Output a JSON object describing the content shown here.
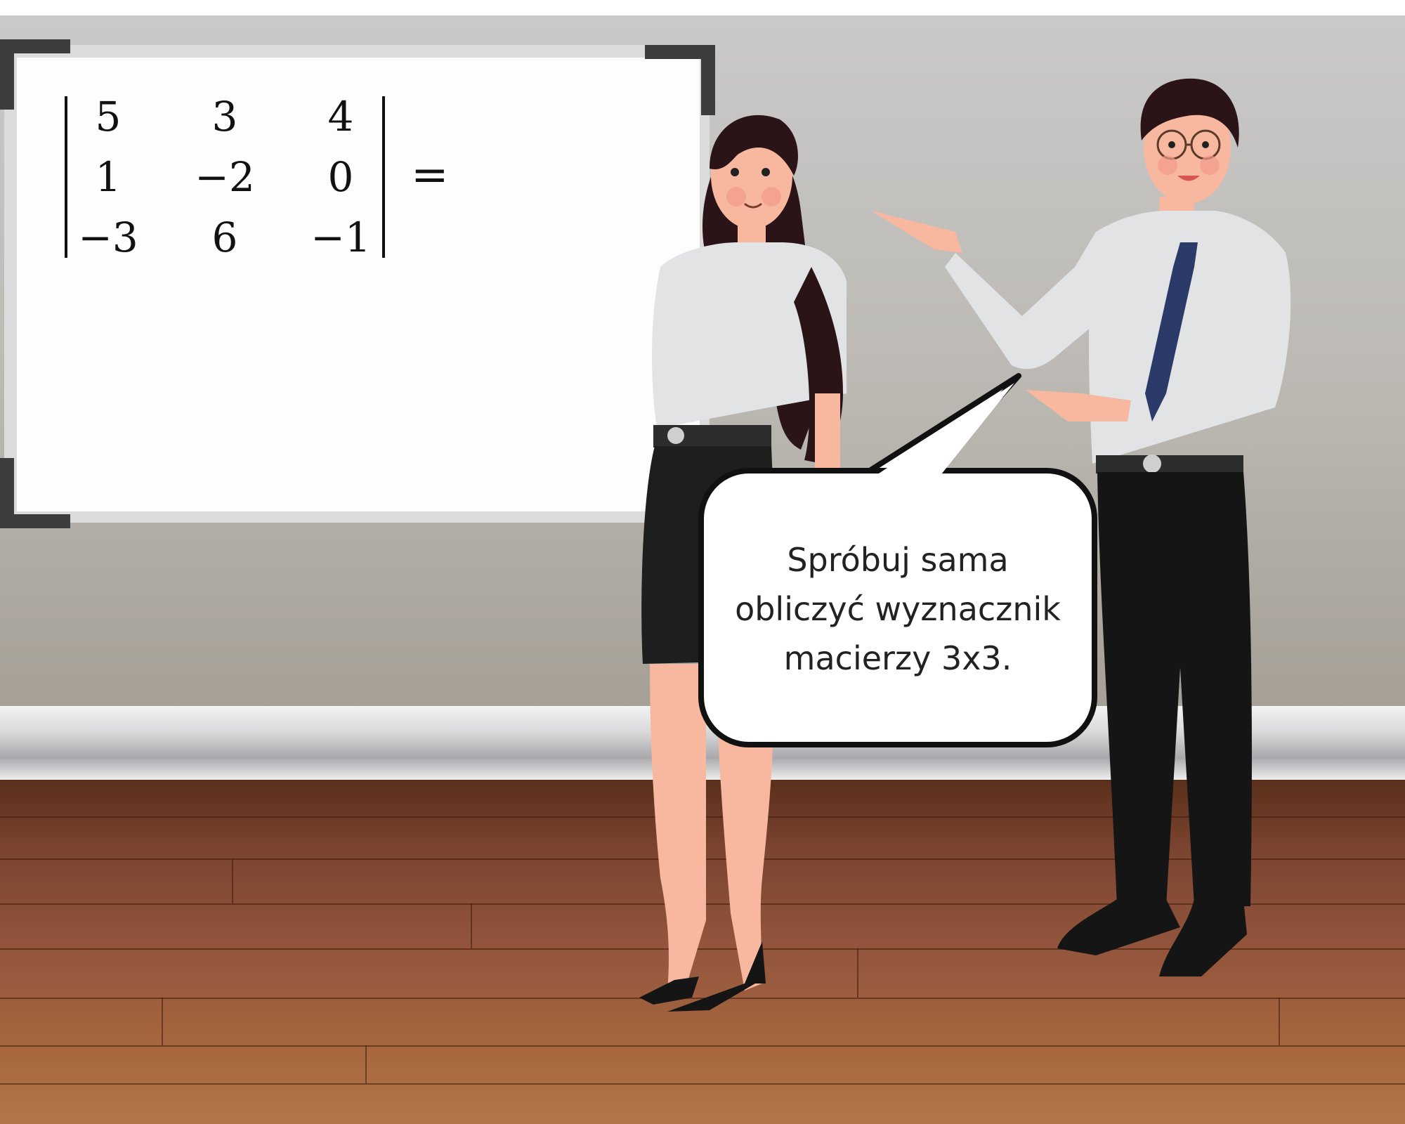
{
  "scene": {
    "colors": {
      "wall": "#c0bcb6",
      "floor": "#94563d",
      "board_frame": "#3d3d3d",
      "shirt": "#e2e3e5",
      "tie": "#2c3a6a",
      "skin": "#f8b8a0",
      "hair": "#2b1418"
    }
  },
  "whiteboard": {
    "determinant": {
      "rows": [
        [
          "5",
          "3",
          "4"
        ],
        [
          "1",
          "−2",
          "0"
        ],
        [
          "−3",
          "6",
          "−1"
        ]
      ],
      "equals": "="
    }
  },
  "speech_bubble": {
    "line1": "Spróbuj sama",
    "line2": "obliczyć wyznacznik",
    "line3": "macierzy 3x3."
  }
}
